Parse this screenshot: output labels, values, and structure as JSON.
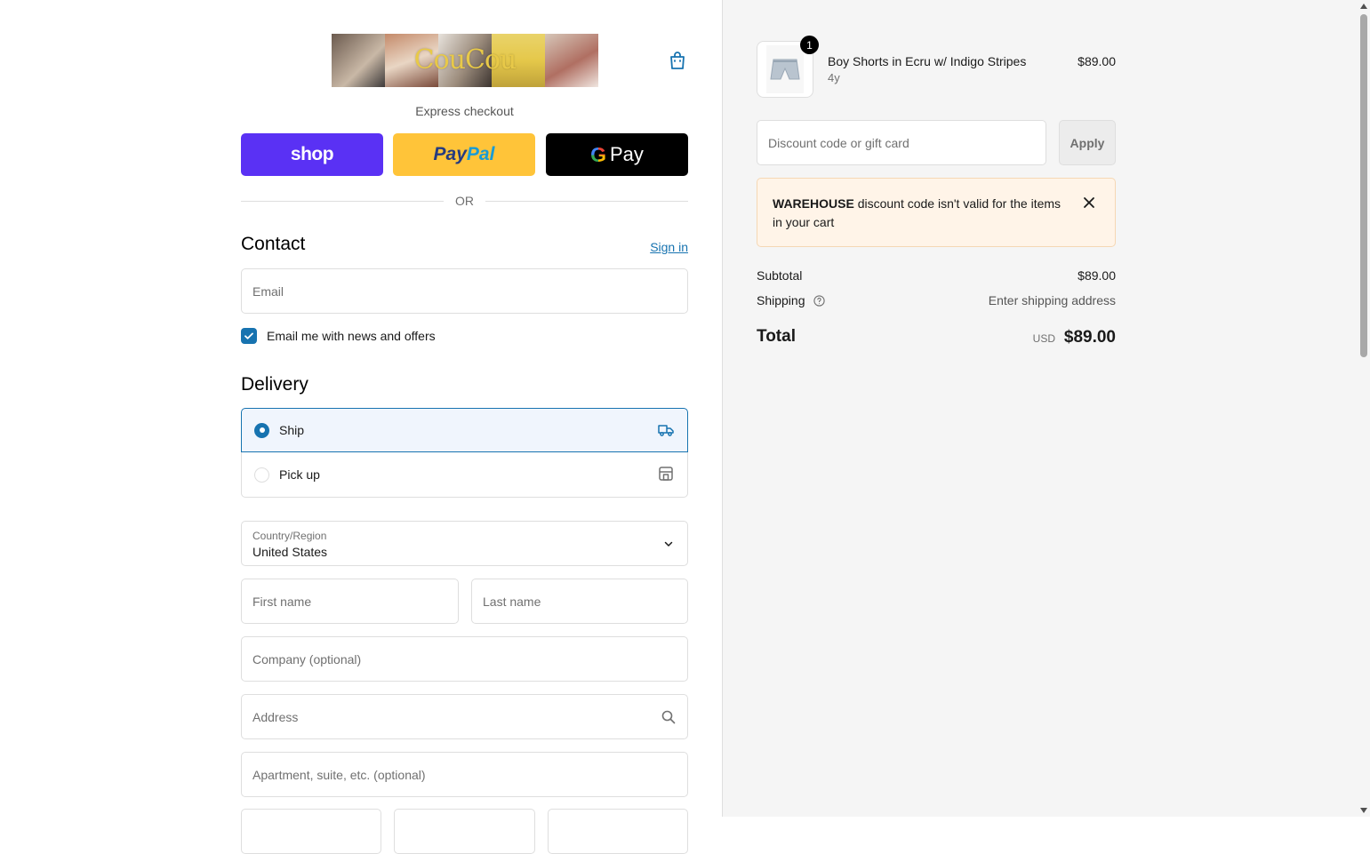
{
  "brand": {
    "logo_text": "CouCou"
  },
  "express": {
    "label": "Express checkout",
    "shop_label": "shop",
    "paypal_part1": "Pay",
    "paypal_part2": "Pal",
    "gpay_g": "G",
    "gpay_label": "Pay"
  },
  "divider": {
    "or_label": "OR"
  },
  "contact": {
    "heading": "Contact",
    "signin_label": "Sign in",
    "email_placeholder": "Email",
    "newsletter_label": "Email me with news and offers",
    "newsletter_checked": true
  },
  "delivery": {
    "heading": "Delivery",
    "options": [
      {
        "label": "Ship",
        "selected": true,
        "icon": "truck-icon"
      },
      {
        "label": "Pick up",
        "selected": false,
        "icon": "store-icon"
      }
    ],
    "country_label": "Country/Region",
    "country_value": "United States",
    "first_name_placeholder": "First name",
    "last_name_placeholder": "Last name",
    "company_placeholder": "Company (optional)",
    "address_placeholder": "Address",
    "apartment_placeholder": "Apartment, suite, etc. (optional)"
  },
  "cart": {
    "item": {
      "quantity": "1",
      "name": "Boy Shorts in Ecru w/ Indigo Stripes",
      "variant": "4y",
      "price": "$89.00"
    },
    "discount_placeholder": "Discount code or gift card",
    "apply_label": "Apply",
    "warning": {
      "code": "WAREHOUSE",
      "message": "discount code isn't valid for the items in your cart"
    },
    "subtotal_label": "Subtotal",
    "subtotal_value": "$89.00",
    "shipping_label": "Shipping",
    "shipping_value": "Enter shipping address",
    "total_label": "Total",
    "currency": "USD",
    "total_value": "$89.00"
  },
  "colors": {
    "accent": "#1773b0",
    "shop": "#5a31f4",
    "paypal": "#ffc439",
    "gpay": "#000000",
    "warning_bg": "#fff4e8"
  }
}
